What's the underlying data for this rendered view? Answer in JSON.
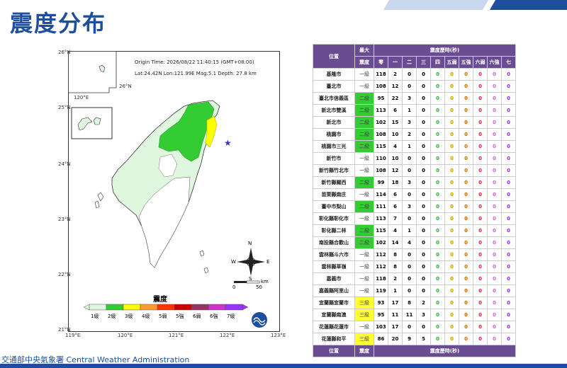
{
  "page_title": "震度分布",
  "origin": {
    "line1": "Origin Time: 2026/08/22   11:40:15   (GMT+08:00)",
    "line2": "Lat:24.42N  Lon:121.99E  Mag:5.1  Depth: 27.8 km"
  },
  "map": {
    "lat_labels": [
      "26°N",
      "25°N",
      "24°N",
      "23°N",
      "22°N",
      "21°N"
    ],
    "lon_labels": [
      "119°E",
      "120°E",
      "121°E",
      "122°E",
      "123°E"
    ],
    "inset_lat": "26°N",
    "inset_lon": "120°E",
    "compass": {
      "n": "N",
      "s": "S",
      "e": "E",
      "w": "W"
    },
    "scale": {
      "start": "0",
      "end": "50",
      "unit": "km"
    }
  },
  "legend": {
    "title": "震度",
    "levels": [
      {
        "label": "1級",
        "color": "#dff7df"
      },
      {
        "label": "2級",
        "color": "#33cc33"
      },
      {
        "label": "3級",
        "color": "#ffff00"
      },
      {
        "label": "4級",
        "color": "#ff9933"
      },
      {
        "label": "5弱",
        "color": "#ff3300"
      },
      {
        "label": "5強",
        "color": "#cc0000"
      },
      {
        "label": "6弱",
        "color": "#993366"
      },
      {
        "label": "6強",
        "color": "#cc33cc"
      },
      {
        "label": "7級",
        "color": "#9933ff"
      }
    ]
  },
  "table": {
    "header": {
      "station": "位置",
      "max": "最大",
      "max2": "震度",
      "history": "震度歷時(秒)"
    },
    "columns": [
      "零",
      "一",
      "二",
      "三",
      "四",
      "五弱",
      "五強",
      "六弱",
      "六強",
      "七"
    ],
    "rows": [
      {
        "name": "基隆市",
        "level": "一級",
        "vals": [
          "118",
          "2",
          "0",
          "0",
          "0",
          "0",
          "0",
          "0",
          "0",
          "0"
        ]
      },
      {
        "name": "臺北市",
        "level": "一級",
        "vals": [
          "108",
          "12",
          "0",
          "0",
          "0",
          "0",
          "0",
          "0",
          "0",
          "0"
        ]
      },
      {
        "name": "臺北市信義區",
        "level": "二級",
        "vals": [
          "95",
          "22",
          "3",
          "0",
          "0",
          "0",
          "0",
          "0",
          "0",
          "0"
        ]
      },
      {
        "name": "新北市雙溪",
        "level": "二級",
        "vals": [
          "113",
          "6",
          "1",
          "0",
          "0",
          "0",
          "0",
          "0",
          "0",
          "0"
        ]
      },
      {
        "name": "新北市",
        "level": "二級",
        "vals": [
          "102",
          "15",
          "3",
          "0",
          "0",
          "0",
          "0",
          "0",
          "0",
          "0"
        ]
      },
      {
        "name": "桃園市",
        "level": "二級",
        "vals": [
          "108",
          "10",
          "2",
          "0",
          "0",
          "0",
          "0",
          "0",
          "0",
          "0"
        ]
      },
      {
        "name": "桃園市三光",
        "level": "二級",
        "vals": [
          "115",
          "4",
          "1",
          "0",
          "0",
          "0",
          "0",
          "0",
          "0",
          "0"
        ]
      },
      {
        "name": "新竹市",
        "level": "一級",
        "vals": [
          "110",
          "10",
          "0",
          "0",
          "0",
          "0",
          "0",
          "0",
          "0",
          "0"
        ]
      },
      {
        "name": "新竹縣竹北市",
        "level": "一級",
        "vals": [
          "108",
          "12",
          "0",
          "0",
          "0",
          "0",
          "0",
          "0",
          "0",
          "0"
        ]
      },
      {
        "name": "新竹縣關西",
        "level": "二級",
        "vals": [
          "99",
          "18",
          "3",
          "0",
          "0",
          "0",
          "0",
          "0",
          "0",
          "0"
        ]
      },
      {
        "name": "苗栗縣南庄",
        "level": "一級",
        "vals": [
          "114",
          "6",
          "0",
          "0",
          "0",
          "0",
          "0",
          "0",
          "0",
          "0"
        ]
      },
      {
        "name": "臺中市梨山",
        "level": "二級",
        "vals": [
          "111",
          "6",
          "3",
          "0",
          "0",
          "0",
          "0",
          "0",
          "0",
          "0"
        ]
      },
      {
        "name": "彰化縣彰化市",
        "level": "一級",
        "vals": [
          "113",
          "7",
          "0",
          "0",
          "0",
          "0",
          "0",
          "0",
          "0",
          "0"
        ]
      },
      {
        "name": "彰化縣二林",
        "level": "二級",
        "vals": [
          "115",
          "4",
          "1",
          "0",
          "0",
          "0",
          "0",
          "0",
          "0",
          "0"
        ]
      },
      {
        "name": "南投縣合歡山",
        "level": "二級",
        "vals": [
          "102",
          "14",
          "4",
          "0",
          "0",
          "0",
          "0",
          "0",
          "0",
          "0"
        ]
      },
      {
        "name": "雲林縣斗六市",
        "level": "一級",
        "vals": [
          "112",
          "8",
          "0",
          "0",
          "0",
          "0",
          "0",
          "0",
          "0",
          "0"
        ]
      },
      {
        "name": "雲林縣草嶺",
        "level": "一級",
        "vals": [
          "112",
          "8",
          "0",
          "0",
          "0",
          "0",
          "0",
          "0",
          "0",
          "0"
        ]
      },
      {
        "name": "嘉義市",
        "level": "一級",
        "vals": [
          "118",
          "2",
          "0",
          "0",
          "0",
          "0",
          "0",
          "0",
          "0",
          "0"
        ]
      },
      {
        "name": "嘉義縣阿里山",
        "level": "一級",
        "vals": [
          "119",
          "1",
          "0",
          "0",
          "0",
          "0",
          "0",
          "0",
          "0",
          "0"
        ]
      },
      {
        "name": "宜蘭縣宜蘭市",
        "level": "三級",
        "vals": [
          "93",
          "17",
          "8",
          "2",
          "0",
          "0",
          "0",
          "0",
          "0",
          "0"
        ]
      },
      {
        "name": "宜蘭縣南澳",
        "level": "三級",
        "vals": [
          "95",
          "11",
          "11",
          "3",
          "0",
          "0",
          "0",
          "0",
          "0",
          "0"
        ]
      },
      {
        "name": "花蓮縣花蓮市",
        "level": "一級",
        "vals": [
          "103",
          "17",
          "0",
          "0",
          "0",
          "0",
          "0",
          "0",
          "0",
          "0"
        ]
      },
      {
        "name": "花蓮縣和平",
        "level": "三級",
        "vals": [
          "86",
          "20",
          "9",
          "5",
          "0",
          "0",
          "0",
          "0",
          "0",
          "0"
        ]
      }
    ],
    "value_colors": [
      "#000000",
      "#000000",
      "#000000",
      "#000000",
      "#33aa33",
      "#cc9900",
      "#cc6600",
      "#cc3333",
      "#cc66cc",
      "#9933cc"
    ],
    "level_colors": {
      "一級": "#ffffff",
      "二級": "#33cc33",
      "三級": "#ffff33"
    }
  },
  "footer": {
    "agency": "交通部中央氣象署 Central Weather Administration"
  },
  "colors": {
    "brand": "#1d4f9e",
    "table_header": "#6a4c93"
  }
}
